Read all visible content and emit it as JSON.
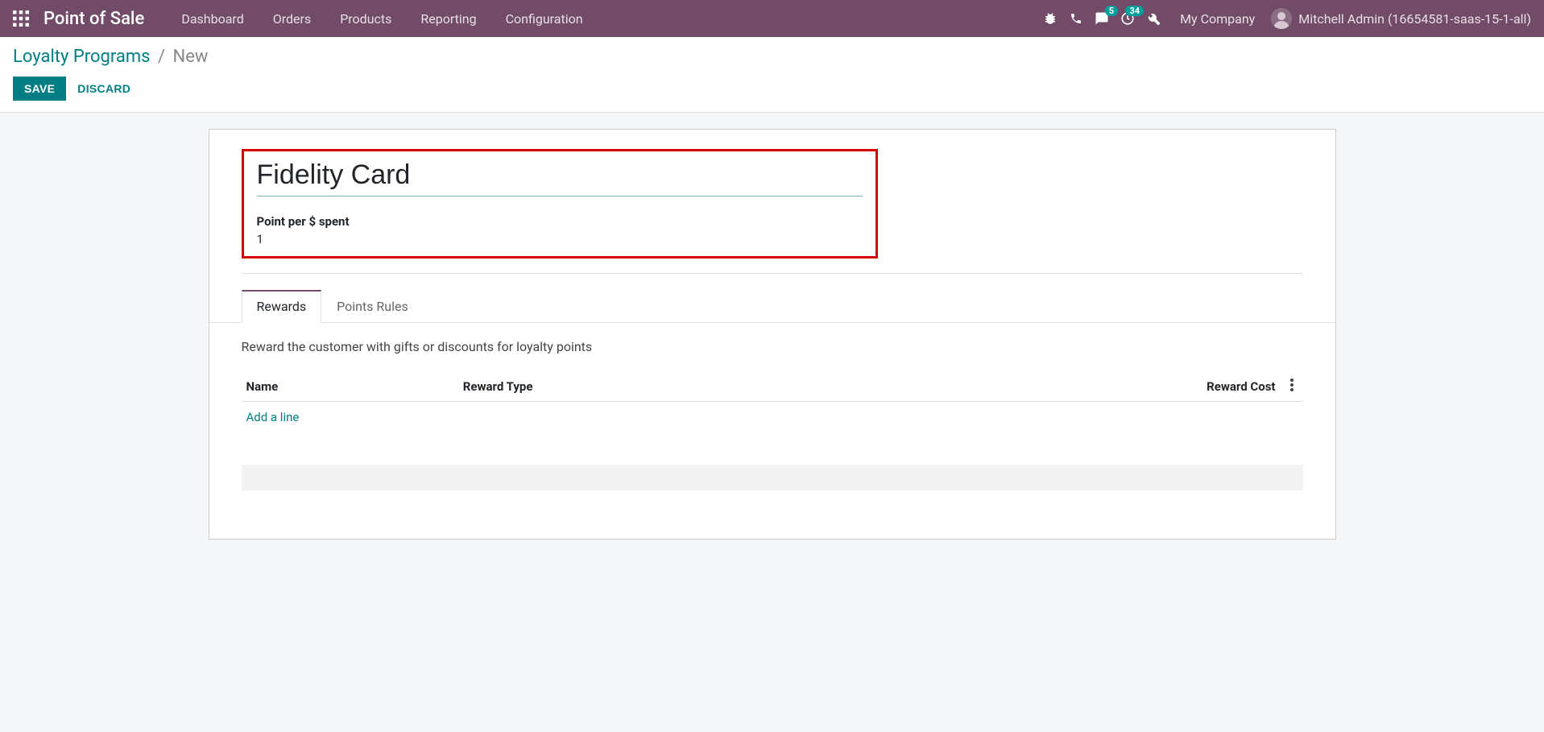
{
  "navbar": {
    "brand": "Point of Sale",
    "menu": [
      "Dashboard",
      "Orders",
      "Products",
      "Reporting",
      "Configuration"
    ],
    "messages_badge": "5",
    "activities_badge": "34",
    "company": "My Company",
    "user": "Mitchell Admin (16654581-saas-15-1-all)"
  },
  "breadcrumbs": {
    "parent": "Loyalty Programs",
    "current": "New"
  },
  "buttons": {
    "save": "SAVE",
    "discard": "DISCARD"
  },
  "form": {
    "name": "Fidelity Card",
    "points_label": "Point per $ spent",
    "points_value": "1"
  },
  "tabs": {
    "rewards": "Rewards",
    "points_rules": "Points Rules"
  },
  "rewards_tab": {
    "description": "Reward the customer with gifts or discounts for loyalty points",
    "columns": {
      "name": "Name",
      "type": "Reward Type",
      "cost": "Reward Cost"
    },
    "add_line": "Add a line"
  }
}
